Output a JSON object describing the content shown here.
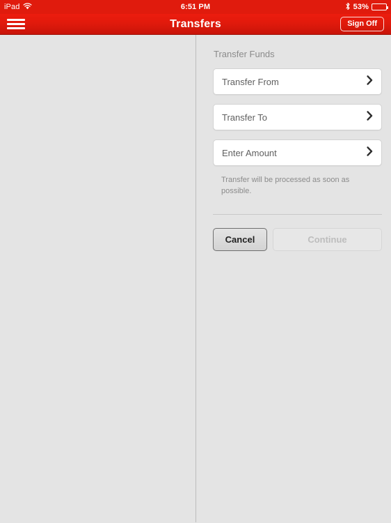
{
  "status_bar": {
    "device": "iPad",
    "wifi_icon": "wifi-icon",
    "time": "6:51 PM",
    "bluetooth_icon": "bluetooth-icon",
    "battery_percent": "53%",
    "battery_level": 53
  },
  "nav_bar": {
    "menu_icon": "hamburger-menu-icon",
    "title": "Transfers",
    "sign_off_label": "Sign Off",
    "background_color": "#e11a0c"
  },
  "main": {
    "section_title": "Transfer Funds",
    "fields": [
      {
        "label": "Transfer From",
        "value": "",
        "chevron_icon": "chevron-right-icon"
      },
      {
        "label": "Transfer To",
        "value": "",
        "chevron_icon": "chevron-right-icon"
      },
      {
        "label": "Enter Amount",
        "value": "",
        "chevron_icon": "chevron-right-icon"
      }
    ],
    "helper_text": "Transfer will be processed as soon as possible.",
    "buttons": {
      "cancel_label": "Cancel",
      "continue_label": "Continue",
      "continue_disabled": true
    }
  }
}
